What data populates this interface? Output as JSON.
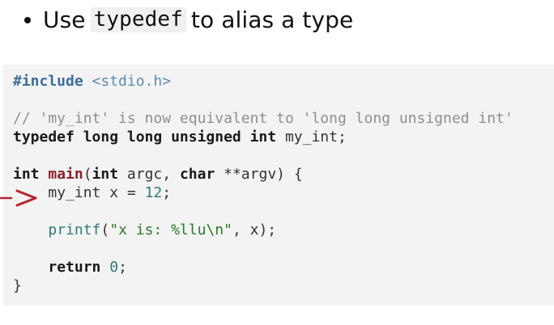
{
  "bullet": {
    "prefix": "Use",
    "code": "typedef",
    "suffix": "to alias a type"
  },
  "code": {
    "include_directive": "#include",
    "include_header": "<stdio.h>",
    "comment": "// 'my_int' is now equivalent to 'long long unsigned int'",
    "typedef_keywords": "typedef long long unsigned int",
    "typedef_name": " my_int;",
    "main_ret_type": "int",
    "main_name": "main",
    "main_open": "(",
    "main_arg1_type": "int",
    "main_arg1_name": " argc, ",
    "main_arg2_type": "char",
    "main_arg2_rest": " **argv) {",
    "decl_indent": "    ",
    "decl_text": "my_int x = ",
    "decl_value": "12",
    "decl_end": ";",
    "printf_indent": "    ",
    "printf_name": "printf",
    "printf_open": "(",
    "printf_string": "\"x is: %llu\\n\"",
    "printf_rest": ", x);",
    "return_indent": "    ",
    "return_keyword": "return",
    "return_space": " ",
    "return_value": "0",
    "return_end": ";",
    "close_brace": "}"
  },
  "colors": {
    "arrow": "#b3262e",
    "panel_bg": "#f3f3f3"
  },
  "icons": {
    "current_line_marker": "right-arrow-icon"
  }
}
